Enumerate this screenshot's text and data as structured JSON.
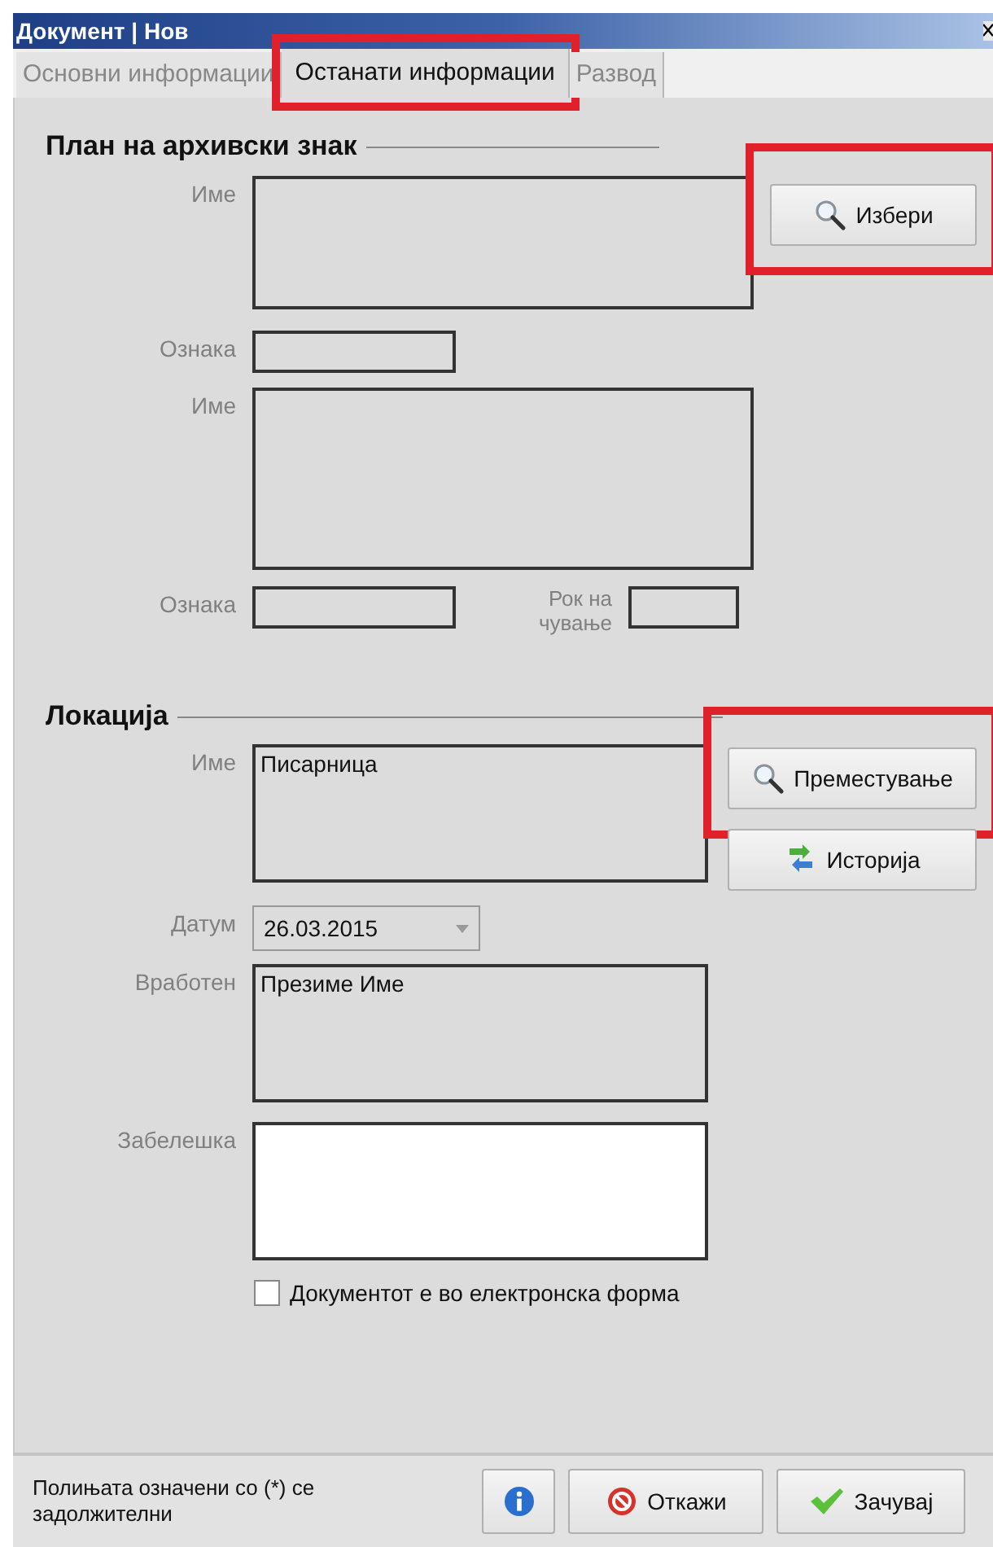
{
  "window": {
    "title": "Документ | Нов"
  },
  "tabs": [
    {
      "label": "Основни информации",
      "selected": false,
      "highlighted": false
    },
    {
      "label": "Останати информации",
      "selected": true,
      "highlighted": true
    },
    {
      "label": "Развод",
      "selected": false,
      "highlighted": false
    }
  ],
  "sections": [
    {
      "title": "План на архивски знак",
      "rows": [
        {
          "fields": [
            {
              "label": "Име",
              "kind": "memo"
            }
          ],
          "buttons": [
            {
              "label": "Избери",
              "kind": "search",
              "highlighted": true
            }
          ]
        },
        {
          "fields": [
            {
              "label": "Ознака",
              "kind": "text"
            }
          ]
        },
        {
          "fields": [
            {
              "label": "Име",
              "kind": "tall"
            }
          ]
        },
        {
          "fields": [
            {
              "label": "Ознака",
              "kind": "text"
            },
            {
              "label": "Рок на чување",
              "kind": "small"
            }
          ]
        }
      ]
    },
    {
      "title": "Локација",
      "rows": [
        {
          "fields": [
            {
              "label": "Име",
              "kind": "memo",
              "value": "Писарница"
            }
          ],
          "buttons": [
            {
              "label": "Преместување",
              "kind": "search",
              "highlighted": true
            },
            {
              "label": "Историја",
              "kind": "history",
              "highlighted": false
            }
          ]
        },
        {
          "fields": [
            {
              "label": "Датум",
              "kind": "date",
              "value": "26.03.2015"
            }
          ]
        },
        {
          "fields": [
            {
              "label": "Вработен",
              "kind": "memo",
              "value": "Презиме Име"
            }
          ]
        },
        {
          "fields": [
            {
              "label": "Забелешка",
              "kind": "note"
            }
          ]
        },
        {
          "fields": [
            {
              "label": "Документот е во електронска форма",
              "kind": "checkbox",
              "checked": false
            }
          ]
        }
      ]
    }
  ],
  "footer": {
    "note": "Полињата означени со (*) се задолжителни",
    "buttons": [
      {
        "kind": "info"
      },
      {
        "label": "Откажи",
        "kind": "cancel"
      },
      {
        "label": "Зачувај",
        "kind": "save"
      }
    ]
  }
}
